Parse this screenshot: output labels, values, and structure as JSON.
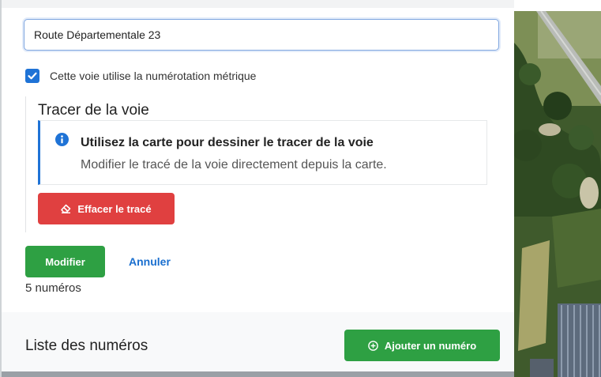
{
  "form": {
    "name_value": "Route Départementale 23",
    "metric_checkbox_label": "Cette voie utilise la numérotation métrique",
    "metric_checked": true
  },
  "trace": {
    "title": "Tracer de la voie",
    "notice_title": "Utilisez la carte pour dessiner le tracer de la voie",
    "notice_text": "Modifier le tracé de la voie directement depuis la carte.",
    "clear_button_label": "Effacer le tracé"
  },
  "actions": {
    "modify_label": "Modifier",
    "cancel_label": "Annuler"
  },
  "count_text": "5 numéros",
  "numbers_list": {
    "title": "Liste des numéros",
    "add_button_label": "Ajouter un numéro"
  },
  "colors": {
    "accent_blue": "#1f73d6",
    "success_green": "#2ea043",
    "danger_red": "#e04040"
  },
  "icons": {
    "close": "close-icon",
    "info": "info-icon",
    "eraser": "eraser-icon",
    "add": "plus-circle-icon",
    "checkbox": "check-icon"
  }
}
